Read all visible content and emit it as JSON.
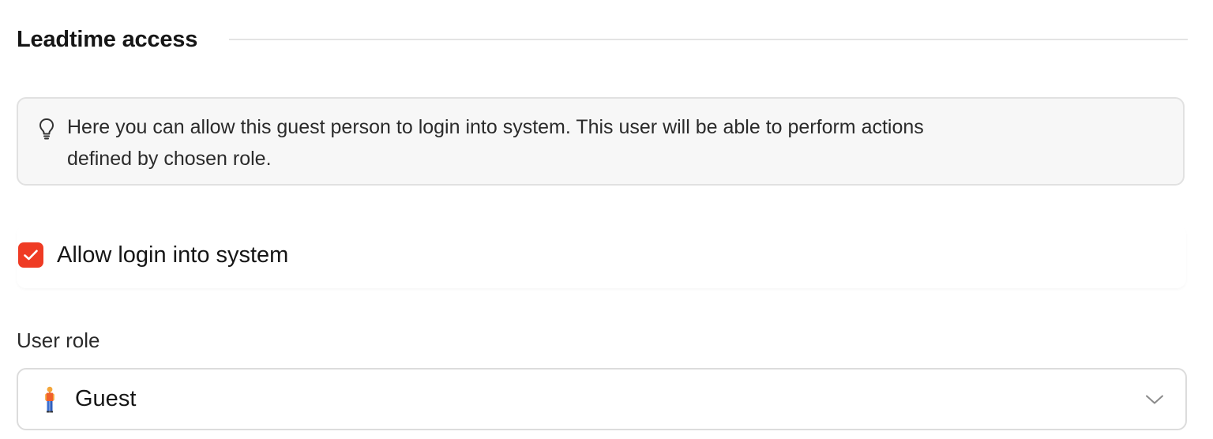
{
  "section": {
    "title": "Leadtime access"
  },
  "info": {
    "icon": "lightbulb-icon",
    "text_line1": "Here you can allow this guest person to login into system. This user will be able to perform actions",
    "text_line2": "defined by chosen role."
  },
  "login": {
    "checked": true,
    "label": "Allow login into system",
    "accent_color": "#ef3b24"
  },
  "role_field": {
    "label": "User role",
    "selected_value": "Guest",
    "icon": "person-standing-icon",
    "dropdown_icon": "chevron-down-icon"
  }
}
